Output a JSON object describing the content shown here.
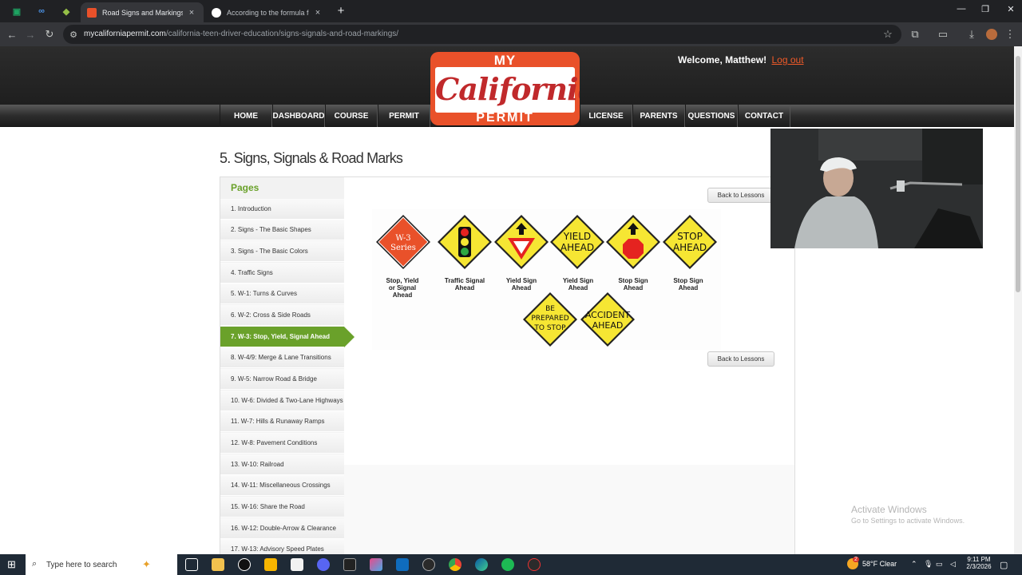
{
  "browser": {
    "tabs": [
      {
        "title": "Road Signs and Markings | Driv",
        "active": true
      },
      {
        "title": "According to the formula for st",
        "active": false
      }
    ],
    "url_domain": "mycaliforniapermit.com",
    "url_path": "/california-teen-driver-education/signs-signals-and-road-markings/",
    "new_tab": "+",
    "close_glyph": "×"
  },
  "header": {
    "welcome": "Welcome, Matthew!",
    "logout": "Log out",
    "logo": {
      "top": "MY",
      "middle": "California",
      "bottom": "PERMIT"
    }
  },
  "nav": [
    "HOME",
    "DASHBOARD",
    "COURSE",
    "PERMIT",
    "LICENSE",
    "PARENTS",
    "QUESTIONS",
    "CONTACT"
  ],
  "page": {
    "title": "5. Signs, Signals & Road Marks",
    "sidebar_heading": "Pages",
    "active_index": 6,
    "sidebar_items": [
      "1. Introduction",
      "2. Signs - The Basic Shapes",
      "3. Signs - The Basic Colors",
      "4. Traffic Signs",
      "5. W-1: Turns & Curves",
      "6. W-2: Cross & Side Roads",
      "7. W-3: Stop, Yield, Signal Ahead",
      "8. W-4/9: Merge & Lane Transitions",
      "9. W-5: Narrow Road & Bridge",
      "10. W-6: Divided & Two-Lane Highways",
      "11. W-7: Hills & Runaway Ramps",
      "12. W-8: Pavement Conditions",
      "13. W-10: Railroad",
      "14. W-11: Miscellaneous Crossings",
      "15. W-16: Share the Road",
      "16. W-12: Double-Arrow & Clearance",
      "17. W-13: Advisory Speed Plates"
    ],
    "back_button": "Back to Lessons"
  },
  "signs": {
    "series_sign": {
      "line1": "W-3",
      "line2": "Series",
      "caption": [
        "Stop, Yield",
        "or Signal",
        "Ahead"
      ]
    },
    "traffic_signal": {
      "caption": [
        "Traffic Signal",
        "Ahead"
      ]
    },
    "yield_symbol": {
      "caption": [
        "Yield Sign",
        "Ahead"
      ]
    },
    "yield_text": {
      "line1": "YIELD",
      "line2": "AHEAD",
      "caption": [
        "Yield Sign",
        "Ahead"
      ]
    },
    "stop_symbol": {
      "caption": [
        "Stop Sign",
        "Ahead"
      ]
    },
    "stop_text": {
      "line1": "STOP",
      "line2": "AHEAD",
      "caption": [
        "Stop Sign",
        "Ahead"
      ]
    },
    "be_prepared": {
      "line1": "BE",
      "line2": "PREPARED",
      "line3": "TO STOP"
    },
    "accident": {
      "line1": "ACCIDENT",
      "line2": "AHEAD"
    }
  },
  "overlay": {
    "activate_title": "Activate Windows",
    "activate_sub": "Go to Settings to activate Windows."
  },
  "taskbar": {
    "search_placeholder": "Type here to search",
    "weather": "58°F  Clear",
    "time": "9:11 PM",
    "date": "2/3/2026",
    "weather_badge": "2"
  },
  "colors": {
    "accent_green": "#6aa12a",
    "brand_orange": "#e9512a",
    "warning_yellow": "#f6e633",
    "logout_link": "#f05a28"
  }
}
